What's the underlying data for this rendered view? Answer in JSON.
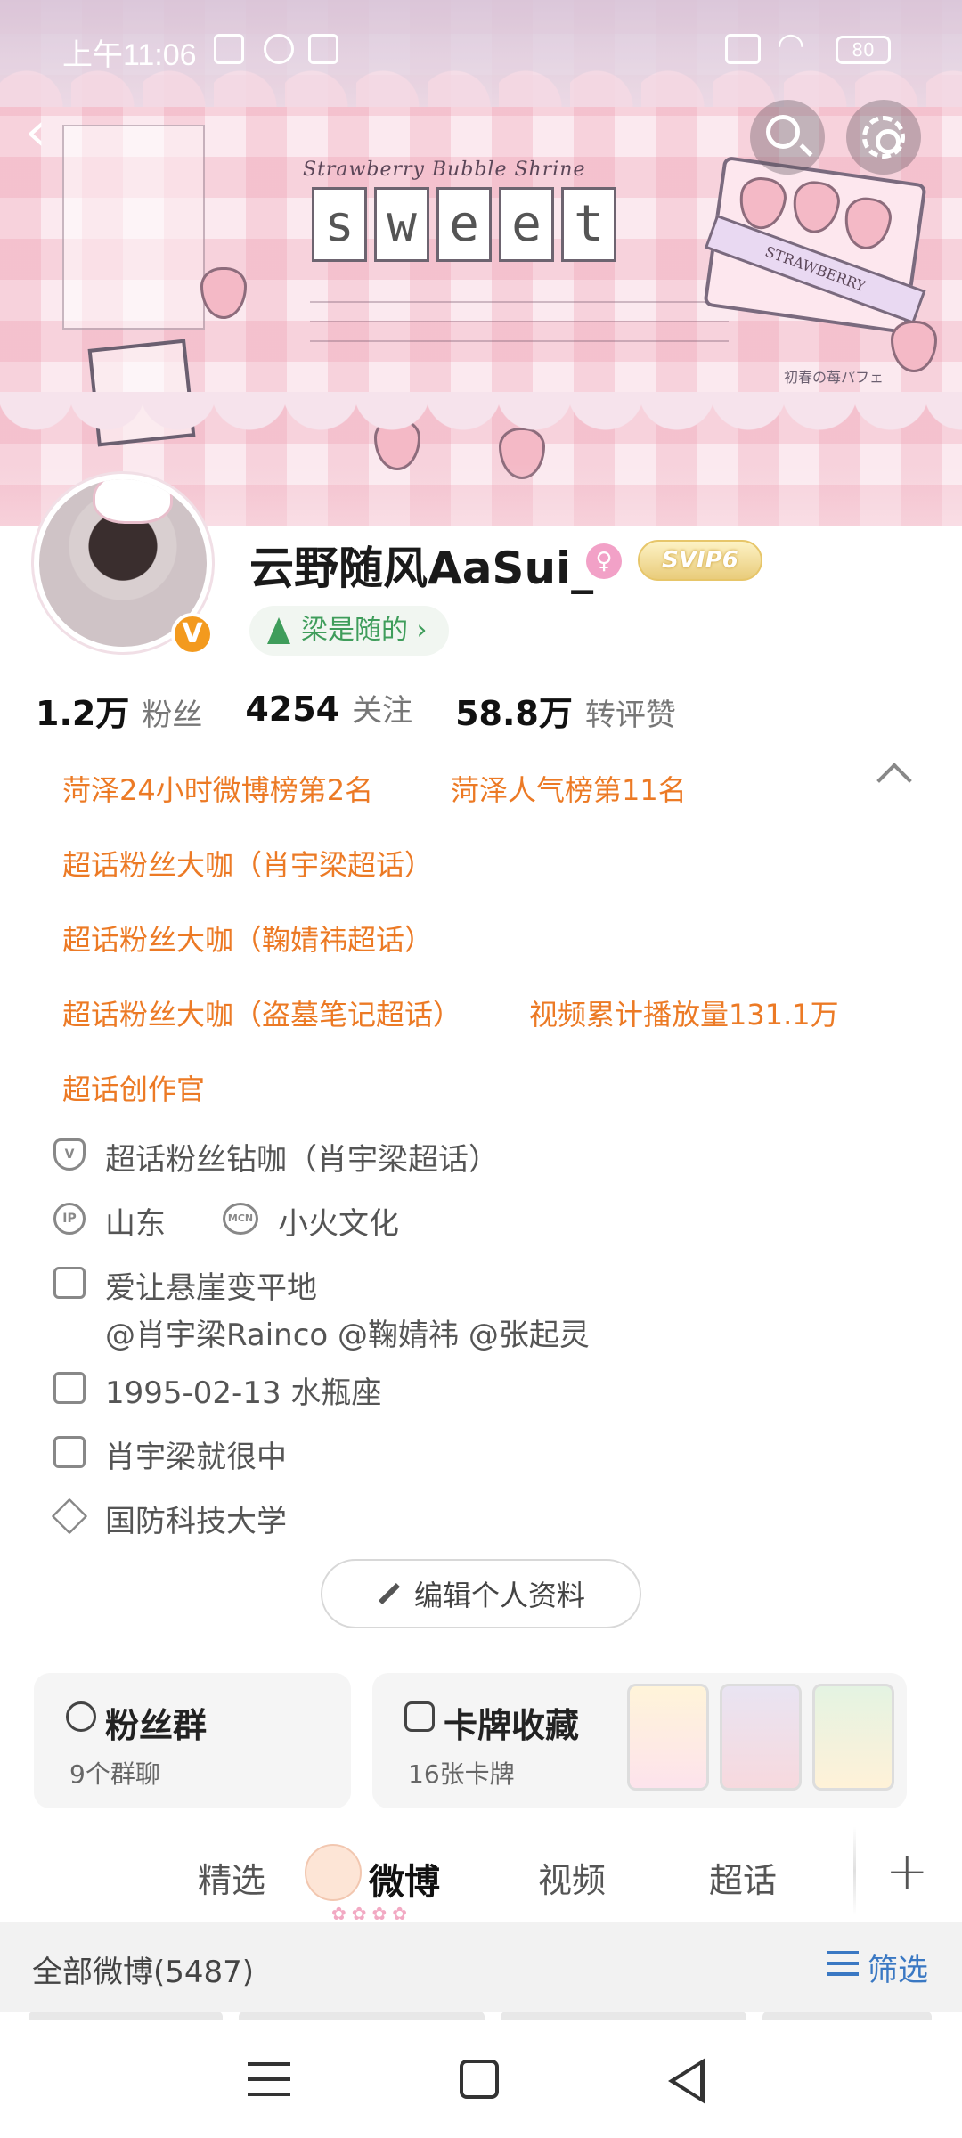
{
  "status_bar": {
    "time": "上午11:06",
    "battery": "80"
  },
  "banner": {
    "title": "Strawberry Bubble Shrine",
    "word_letters": [
      "s",
      "w",
      "e",
      "e",
      "t"
    ],
    "box_label": "STRAWBERRY",
    "corner_text": "初春の苺パフェ"
  },
  "profile": {
    "username": "云野随风AaSui_",
    "gender_symbol": "♀",
    "vip_badge": "SVIP6",
    "verified_mark": "V",
    "tag_label": "梁是随的 ›"
  },
  "stats": [
    {
      "value": "1.2万",
      "label": "粉丝"
    },
    {
      "value": "4254",
      "label": "关注"
    },
    {
      "value": "58.8万",
      "label": "转评赞"
    }
  ],
  "honors": [
    "菏泽24小时微博榜第2名",
    "菏泽人气榜第11名",
    "超话粉丝大咖（肖宇梁超话）",
    "超话粉丝大咖（鞠婧祎超话）",
    "超话粉丝大咖（盗墓笔记超话）",
    "视频累计播放量131.1万",
    "超话创作官"
  ],
  "info": {
    "fan_rank": "超话粉丝钻咖（肖宇梁超话）",
    "ip_badge": "IP",
    "location": "山东",
    "mcn_badge": "MCN",
    "mcn": "小火文化",
    "bio": "爱让悬崖变平地",
    "mentions": "@肖宇梁Rainco @鞠婧祎 @张起灵",
    "birthday": "1995-02-13 水瓶座",
    "company": "肖宇梁就很中",
    "school": "国防科技大学"
  },
  "edit_button": "编辑个人资料",
  "cards": {
    "fan_group": {
      "title": "粉丝群",
      "sub": "9个群聊"
    },
    "card_collection": {
      "title": "卡牌收藏",
      "sub": "16张卡牌"
    }
  },
  "tabs": [
    "精选",
    "微博",
    "视频",
    "超话"
  ],
  "tab_plus": "+",
  "filter_bar": {
    "count": "全部微博(5487)",
    "filter_label": "筛选"
  },
  "colors": {
    "honor": "#ec7a25",
    "accent_blue": "#3a78c3",
    "tag_green": "#3f9d5b",
    "verified_orange": "#f39a1e"
  },
  "icons": {
    "back": "chevron-left-icon",
    "search": "search-icon",
    "settings": "gear-icon",
    "fan_rank": "shield-v-icon",
    "location": "ip-icon",
    "mcn": "mcn-icon",
    "bio": "document-icon",
    "birthday": "calendar-icon",
    "company": "building-icon",
    "school": "graduation-cap-icon",
    "edit": "pencil-icon",
    "fan_group": "people-icon",
    "card_collection": "card-star-icon",
    "filter": "filter-icon",
    "nav_menu": "menu-icon",
    "nav_home": "square-icon",
    "nav_back": "triangle-back-icon"
  }
}
